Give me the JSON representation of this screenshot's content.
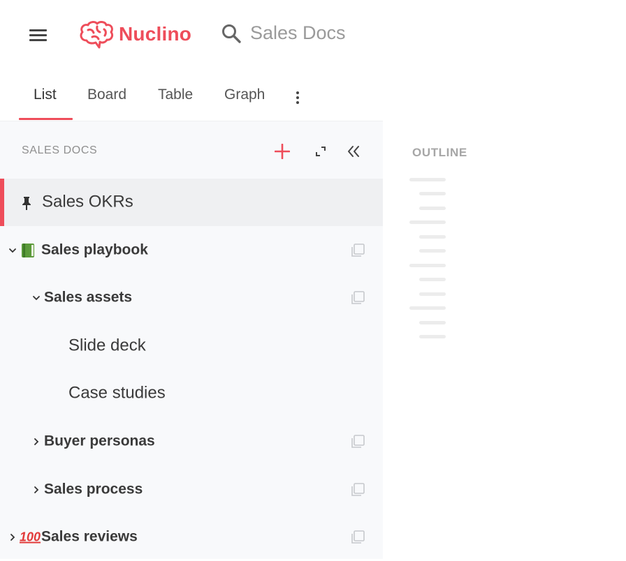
{
  "header": {
    "app_name": "Nuclino",
    "search_text": "Sales Docs",
    "brand_color": "#ee4d5a",
    "icons": {
      "menu": "hamburger-menu-icon",
      "logo": "brain-logo-icon",
      "search": "search-icon"
    }
  },
  "tabs": {
    "items": [
      {
        "label": "List",
        "active": true
      },
      {
        "label": "Board",
        "active": false
      },
      {
        "label": "Table",
        "active": false
      },
      {
        "label": "Graph",
        "active": false
      }
    ],
    "more_icon": "vertical-dots-icon"
  },
  "sidebar": {
    "title": "SALES DOCS",
    "icons": {
      "add": "plus-icon",
      "expand": "expand-icon",
      "collapse": "double-chevron-left-icon"
    },
    "items": [
      {
        "label": "Sales OKRs",
        "pinned": true,
        "selected": true
      },
      {
        "label": "Sales playbook",
        "emoji": "green-book-emoji",
        "expanded": true
      },
      {
        "label": "Sales assets",
        "expanded": true
      },
      {
        "label": "Slide deck"
      },
      {
        "label": "Case studies"
      },
      {
        "label": "Buyer personas",
        "expanded": false
      },
      {
        "label": "Sales process",
        "expanded": false
      },
      {
        "label": "Sales reviews",
        "emoji": "hundred-points-emoji",
        "emoji_text": "100",
        "expanded": false
      }
    ]
  },
  "outline": {
    "title": "OUTLINE"
  }
}
